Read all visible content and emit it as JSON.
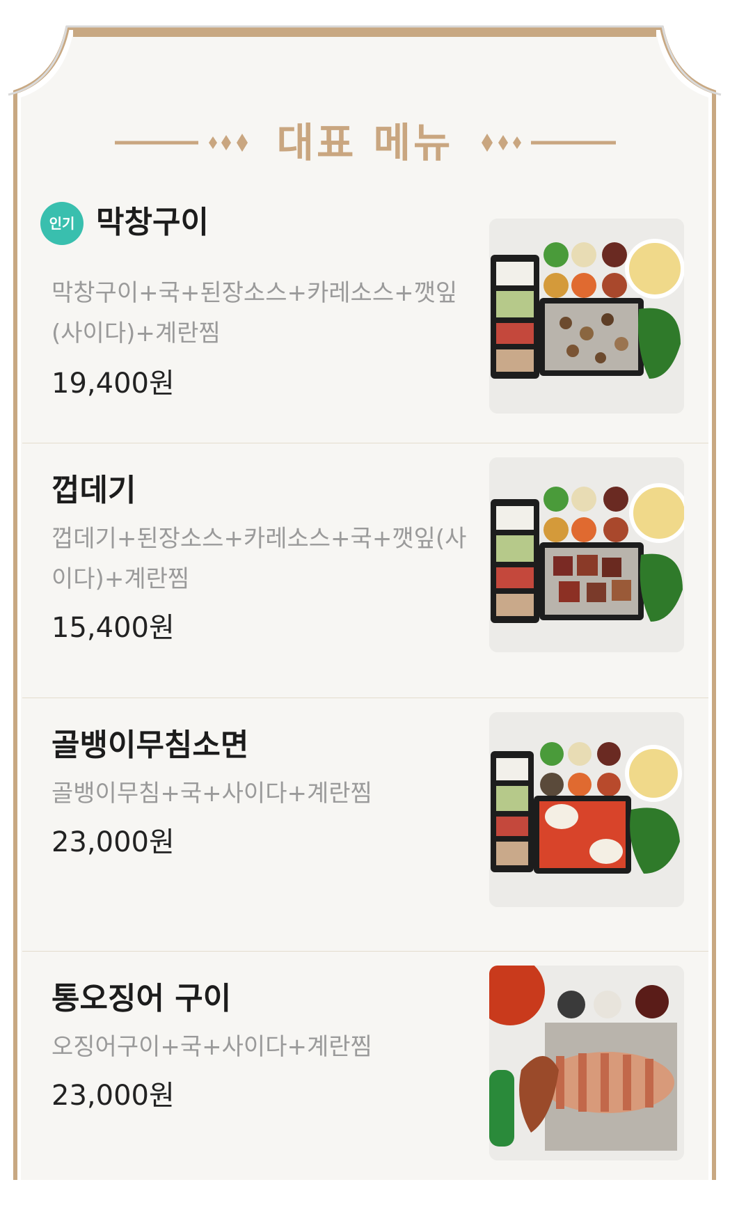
{
  "section": {
    "title": "대표 메뉴"
  },
  "colors": {
    "accent": "#c9a680",
    "frame": "#c8a882",
    "badge": "#39bfae",
    "text": "#1c1c1c",
    "muted": "#9a9a9a"
  },
  "menu": [
    {
      "name": "막창구이",
      "badge": "인기",
      "desc": "막창구이+국+된장소스+카레소스+깻잎(사이다)+계란찜",
      "price": "19,400원",
      "image": "makchang-gui-photo"
    },
    {
      "name": "껍데기",
      "badge": "",
      "desc": "껍데기+된장소스+카레소스+국+깻잎(사이다)+계란찜",
      "price": "15,400원",
      "image": "kkeopdegi-photo"
    },
    {
      "name": "골뱅이무침소면",
      "badge": "",
      "desc": "골뱅이무침+국+사이다+계란찜",
      "price": "23,000원",
      "image": "golbaengi-somyeon-photo"
    },
    {
      "name": "통오징어 구이",
      "badge": "",
      "desc": "오징어구이+국+사이다+계란찜",
      "price": "23,000원",
      "image": "squid-gui-photo"
    }
  ]
}
